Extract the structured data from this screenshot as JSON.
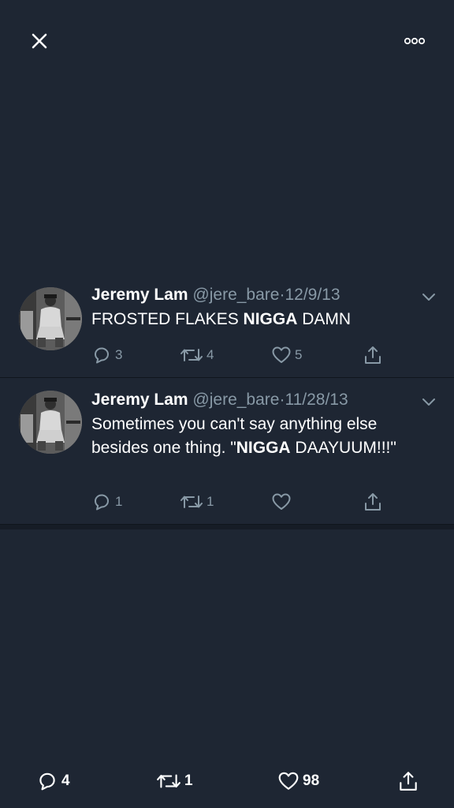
{
  "topbar": {
    "close_icon": "close-icon",
    "more_icon": "more-options-icon"
  },
  "tweets": [
    {
      "name": "Jeremy Lam",
      "handle": "@jere_bare",
      "separator": "·",
      "date": "12/9/13",
      "text_parts": [
        "FROSTED FLAKES ",
        "NIGGA",
        " DAMN"
      ],
      "reply_count": "3",
      "retweet_count": "4",
      "like_count": "5",
      "share_count": ""
    },
    {
      "name": "Jeremy Lam",
      "handle": "@jere_bare",
      "separator": "·",
      "date": "11/28/13",
      "text_parts": [
        "Sometimes you can't say anything else besides one thing. \"",
        "NIGGA",
        " DAAYUUM!!!\""
      ],
      "reply_count": "1",
      "retweet_count": "1",
      "like_count": "",
      "share_count": ""
    }
  ],
  "bottom_bar": {
    "reply_count": "4",
    "retweet_count": "1",
    "like_count": "98"
  },
  "colors": {
    "background": "#1e2633",
    "muted_text": "#8899a6",
    "text": "#ffffff"
  }
}
